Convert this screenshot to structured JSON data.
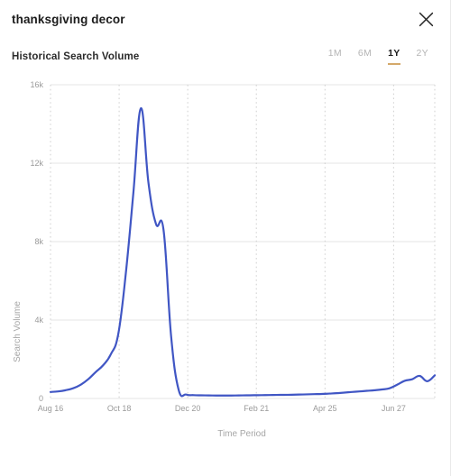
{
  "header": {
    "title": "thanksgiving decor",
    "close_icon": "close-icon"
  },
  "panel": {
    "section_title": "Historical Search Volume",
    "range_tabs": [
      {
        "label": "1M",
        "active": false
      },
      {
        "label": "6M",
        "active": false
      },
      {
        "label": "1Y",
        "active": true
      },
      {
        "label": "2Y",
        "active": false
      }
    ],
    "active_range": "1Y",
    "accent_color": "#d4a96a"
  },
  "chart_data": {
    "type": "line",
    "title": "Historical Search Volume",
    "xlabel": "Time Period",
    "ylabel": "Search Volume",
    "ylim": [
      0,
      16000
    ],
    "yticks": [
      0,
      4000,
      8000,
      12000,
      16000
    ],
    "ytick_labels": [
      "0",
      "4k",
      "8k",
      "12k",
      "16k"
    ],
    "xtick_labels": [
      "Aug 16",
      "Oct 18",
      "Dec 20",
      "Feb 21",
      "Apr 25",
      "Jun 27"
    ],
    "xtick_positions": [
      0,
      0.1786,
      0.3571,
      0.5357,
      0.7143,
      0.8929
    ],
    "grid": {
      "horizontal": true,
      "vertical": true,
      "vertical_style": "dotted"
    },
    "legend": "none",
    "series": [
      {
        "name": "Search Volume",
        "color": "#4056c4",
        "x": [
          "Aug 16",
          "Aug 23",
          "Aug 30",
          "Sep 6",
          "Sep 13",
          "Sep 20",
          "Sep 27",
          "Oct 4",
          "Oct 11",
          "Oct 18",
          "Oct 25",
          "Nov 1",
          "Nov 8",
          "Nov 15",
          "Nov 22",
          "Nov 29",
          "Dec 6",
          "Dec 13",
          "Dec 20",
          "Dec 27",
          "Jan 3",
          "Jan 10",
          "Jan 17",
          "Jan 24",
          "Jan 31",
          "Feb 7",
          "Feb 14",
          "Feb 21",
          "Feb 28",
          "Mar 7",
          "Mar 14",
          "Mar 21",
          "Mar 28",
          "Apr 4",
          "Apr 11",
          "Apr 18",
          "Apr 25",
          "May 2",
          "May 9",
          "May 16",
          "May 23",
          "May 30",
          "Jun 6",
          "Jun 13",
          "Jun 20",
          "Jun 27",
          "Jul 4",
          "Jul 11",
          "Jul 18",
          "Jul 25",
          "Aug 1",
          "Aug 8"
        ],
        "values": [
          330,
          360,
          420,
          520,
          700,
          980,
          1350,
          1700,
          2250,
          3300,
          6400,
          10500,
          14800,
          11000,
          8900,
          8600,
          3200,
          450,
          200,
          170,
          160,
          155,
          150,
          150,
          150,
          155,
          160,
          165,
          170,
          175,
          180,
          185,
          190,
          200,
          210,
          220,
          230,
          250,
          270,
          300,
          330,
          360,
          390,
          420,
          460,
          520,
          700,
          900,
          980,
          1150,
          880,
          1180
        ]
      }
    ]
  }
}
